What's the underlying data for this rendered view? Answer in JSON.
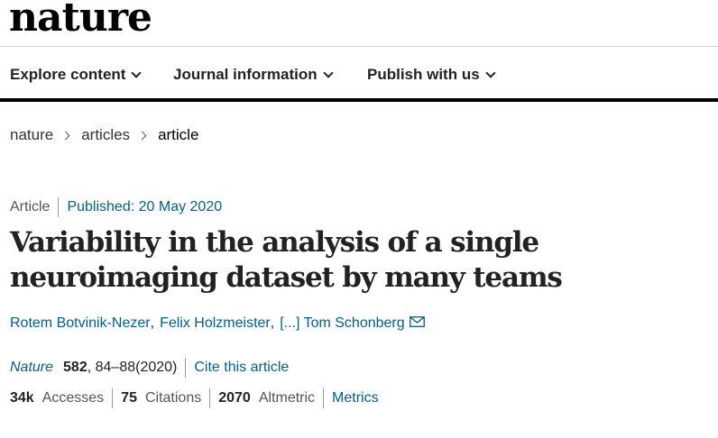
{
  "header": {
    "logo": "nature"
  },
  "nav": {
    "items": [
      {
        "label": "Explore content"
      },
      {
        "label": "Journal information"
      },
      {
        "label": "Publish with us"
      }
    ]
  },
  "breadcrumb": [
    "nature",
    "articles",
    "article"
  ],
  "article": {
    "type": "Article",
    "published": "Published: 20 May 2020",
    "title": "Variability in the analysis of a single neuroimaging dataset by many teams",
    "authors": [
      "Rotem Botvinik-Nezer",
      "Felix Holzmeister",
      "[...] Tom Schonberg"
    ],
    "citation": {
      "journal": "Nature",
      "volume": "582",
      "pages": ", 84–88",
      "year": "(2020)",
      "cite_label": "Cite this article"
    },
    "metrics": {
      "accesses_value": "34k",
      "accesses_label": "Accesses",
      "citations_value": "75",
      "citations_label": "Citations",
      "altmetric_value": "2070",
      "altmetric_label": "Altmetric",
      "metrics_link": "Metrics"
    }
  },
  "colors": {
    "link": "#025e8d",
    "text": "#222222",
    "muted": "#555555"
  }
}
